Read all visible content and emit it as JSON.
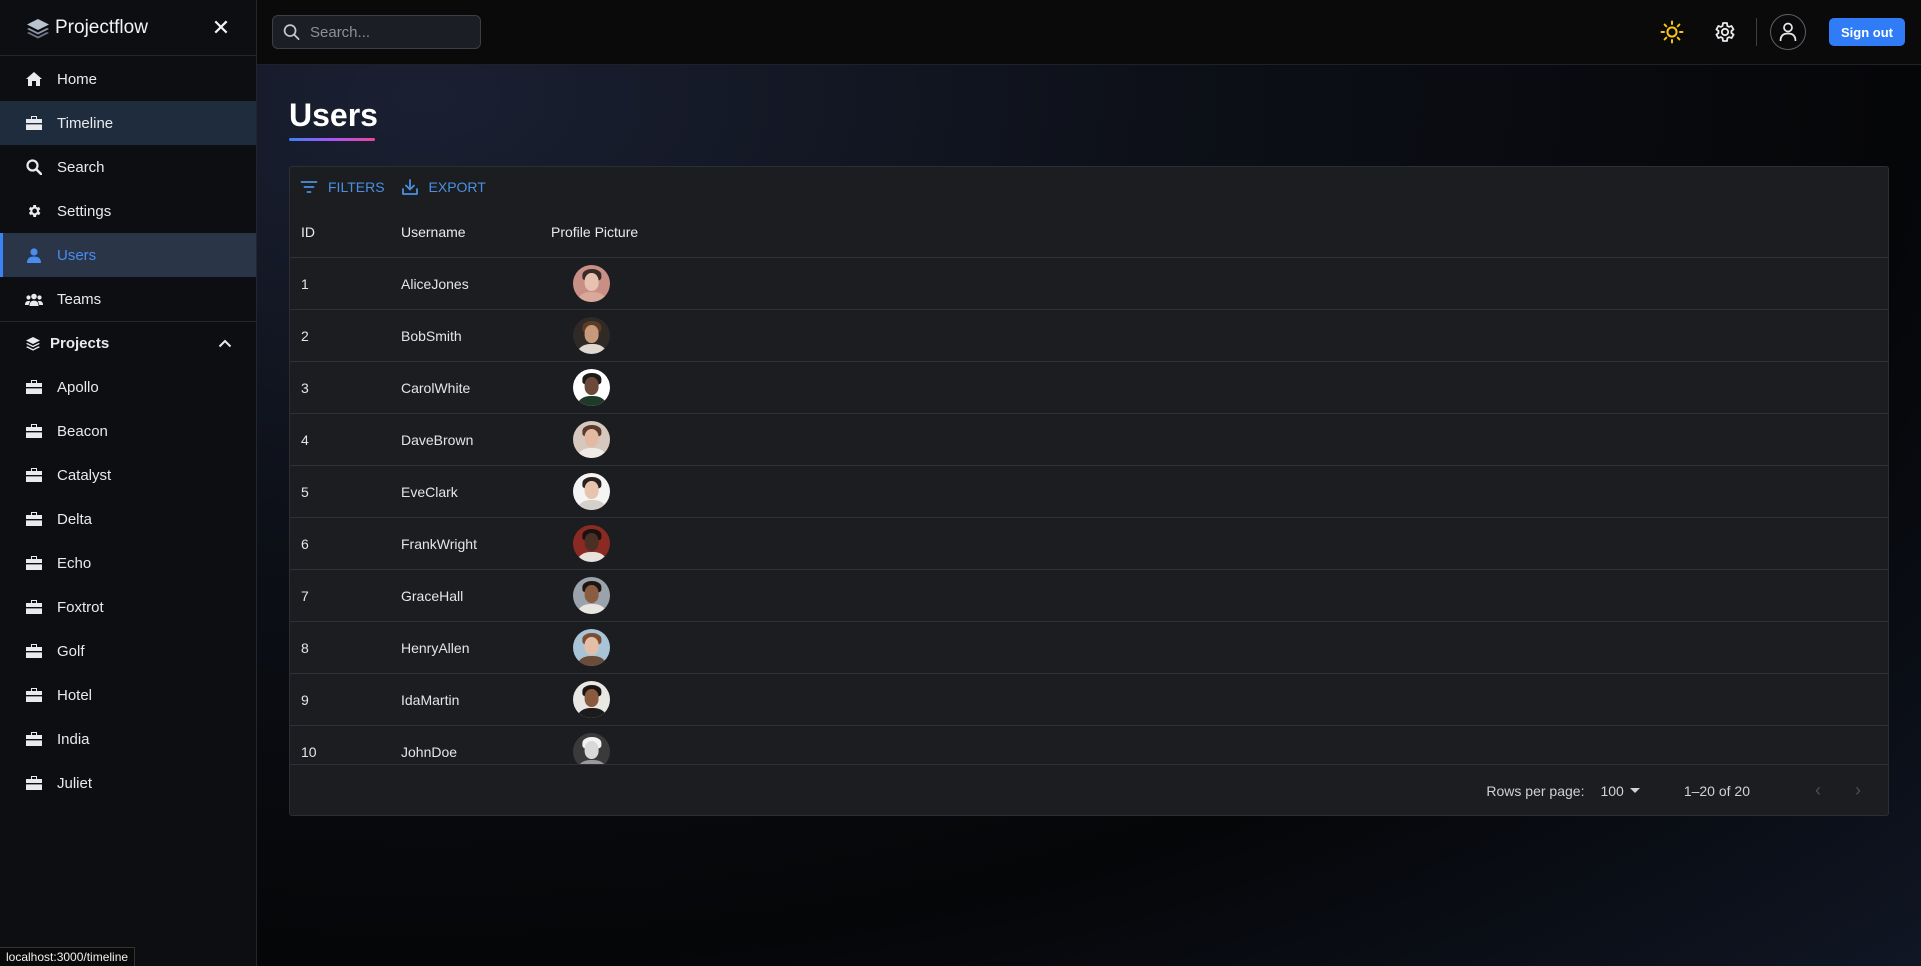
{
  "app": {
    "name": "Projectflow",
    "status_url": "localhost:3000/timeline"
  },
  "sidebar": {
    "items": [
      {
        "label": "Home",
        "icon": "home-icon"
      },
      {
        "label": "Timeline",
        "icon": "briefcase-icon"
      },
      {
        "label": "Search",
        "icon": "search-icon"
      },
      {
        "label": "Settings",
        "icon": "gear-icon"
      },
      {
        "label": "Users",
        "icon": "user-icon"
      },
      {
        "label": "Teams",
        "icon": "group-icon"
      }
    ],
    "projects_header": "Projects",
    "projects": [
      {
        "label": "Apollo"
      },
      {
        "label": "Beacon"
      },
      {
        "label": "Catalyst"
      },
      {
        "label": "Delta"
      },
      {
        "label": "Echo"
      },
      {
        "label": "Foxtrot"
      },
      {
        "label": "Golf"
      },
      {
        "label": "Hotel"
      },
      {
        "label": "India"
      },
      {
        "label": "Juliet"
      }
    ]
  },
  "topbar": {
    "search_placeholder": "Search...",
    "sign_out": "Sign out"
  },
  "page": {
    "title": "Users"
  },
  "grid": {
    "toolbar": {
      "filters": "FILTERS",
      "export": "EXPORT"
    },
    "columns": {
      "id": "ID",
      "username": "Username",
      "profile_picture": "Profile Picture"
    },
    "rows": [
      {
        "id": "1",
        "username": "AliceJones"
      },
      {
        "id": "2",
        "username": "BobSmith"
      },
      {
        "id": "3",
        "username": "CarolWhite"
      },
      {
        "id": "4",
        "username": "DaveBrown"
      },
      {
        "id": "5",
        "username": "EveClark"
      },
      {
        "id": "6",
        "username": "FrankWright"
      },
      {
        "id": "7",
        "username": "GraceHall"
      },
      {
        "id": "8",
        "username": "HenryAllen"
      },
      {
        "id": "9",
        "username": "IdaMartin"
      },
      {
        "id": "10",
        "username": "JohnDoe"
      }
    ],
    "footer": {
      "rows_per_page_label": "Rows per page:",
      "rows_per_page": "100",
      "range": "1–20 of 20"
    }
  },
  "colors": {
    "accent": "#3b82f6",
    "sign_out_bg": "#2f7cf6",
    "sun": "#f5c518"
  }
}
